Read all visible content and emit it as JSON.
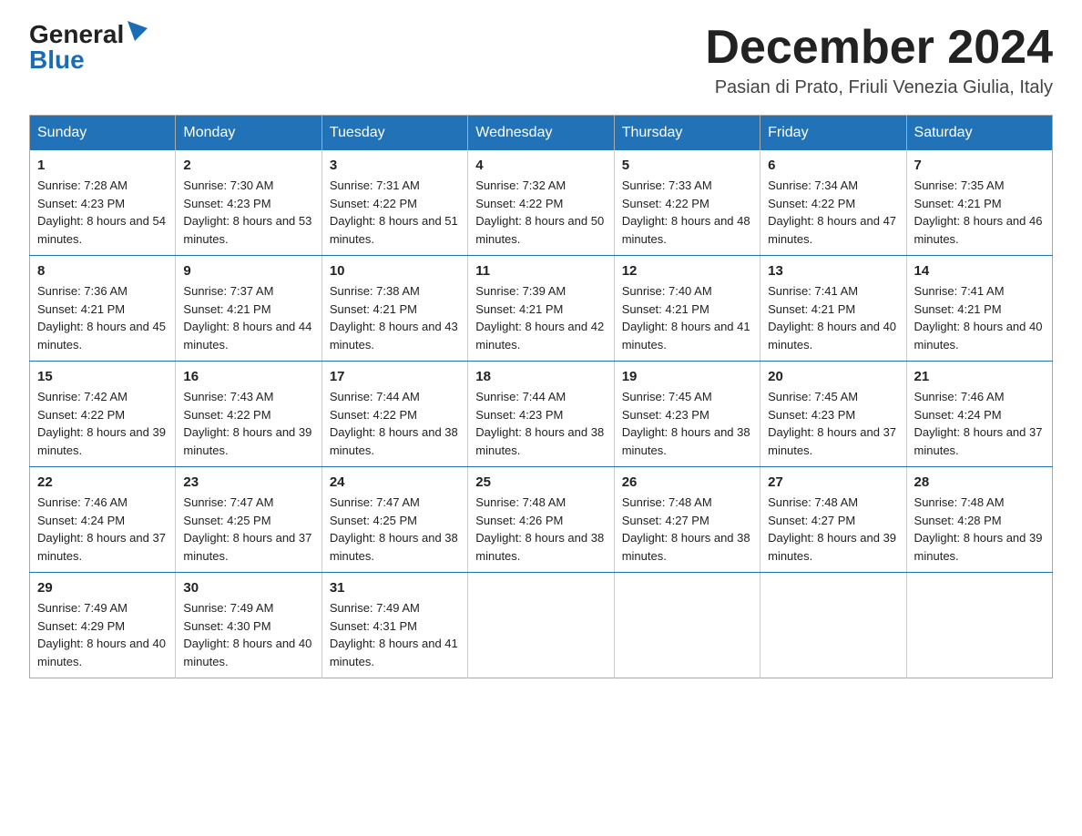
{
  "logo": {
    "general": "General",
    "blue": "Blue"
  },
  "title": "December 2024",
  "location": "Pasian di Prato, Friuli Venezia Giulia, Italy",
  "days_of_week": [
    "Sunday",
    "Monday",
    "Tuesday",
    "Wednesday",
    "Thursday",
    "Friday",
    "Saturday"
  ],
  "weeks": [
    [
      {
        "day": "1",
        "sunrise": "7:28 AM",
        "sunset": "4:23 PM",
        "daylight": "8 hours and 54 minutes."
      },
      {
        "day": "2",
        "sunrise": "7:30 AM",
        "sunset": "4:23 PM",
        "daylight": "8 hours and 53 minutes."
      },
      {
        "day": "3",
        "sunrise": "7:31 AM",
        "sunset": "4:22 PM",
        "daylight": "8 hours and 51 minutes."
      },
      {
        "day": "4",
        "sunrise": "7:32 AM",
        "sunset": "4:22 PM",
        "daylight": "8 hours and 50 minutes."
      },
      {
        "day": "5",
        "sunrise": "7:33 AM",
        "sunset": "4:22 PM",
        "daylight": "8 hours and 48 minutes."
      },
      {
        "day": "6",
        "sunrise": "7:34 AM",
        "sunset": "4:22 PM",
        "daylight": "8 hours and 47 minutes."
      },
      {
        "day": "7",
        "sunrise": "7:35 AM",
        "sunset": "4:21 PM",
        "daylight": "8 hours and 46 minutes."
      }
    ],
    [
      {
        "day": "8",
        "sunrise": "7:36 AM",
        "sunset": "4:21 PM",
        "daylight": "8 hours and 45 minutes."
      },
      {
        "day": "9",
        "sunrise": "7:37 AM",
        "sunset": "4:21 PM",
        "daylight": "8 hours and 44 minutes."
      },
      {
        "day": "10",
        "sunrise": "7:38 AM",
        "sunset": "4:21 PM",
        "daylight": "8 hours and 43 minutes."
      },
      {
        "day": "11",
        "sunrise": "7:39 AM",
        "sunset": "4:21 PM",
        "daylight": "8 hours and 42 minutes."
      },
      {
        "day": "12",
        "sunrise": "7:40 AM",
        "sunset": "4:21 PM",
        "daylight": "8 hours and 41 minutes."
      },
      {
        "day": "13",
        "sunrise": "7:41 AM",
        "sunset": "4:21 PM",
        "daylight": "8 hours and 40 minutes."
      },
      {
        "day": "14",
        "sunrise": "7:41 AM",
        "sunset": "4:21 PM",
        "daylight": "8 hours and 40 minutes."
      }
    ],
    [
      {
        "day": "15",
        "sunrise": "7:42 AM",
        "sunset": "4:22 PM",
        "daylight": "8 hours and 39 minutes."
      },
      {
        "day": "16",
        "sunrise": "7:43 AM",
        "sunset": "4:22 PM",
        "daylight": "8 hours and 39 minutes."
      },
      {
        "day": "17",
        "sunrise": "7:44 AM",
        "sunset": "4:22 PM",
        "daylight": "8 hours and 38 minutes."
      },
      {
        "day": "18",
        "sunrise": "7:44 AM",
        "sunset": "4:23 PM",
        "daylight": "8 hours and 38 minutes."
      },
      {
        "day": "19",
        "sunrise": "7:45 AM",
        "sunset": "4:23 PM",
        "daylight": "8 hours and 38 minutes."
      },
      {
        "day": "20",
        "sunrise": "7:45 AM",
        "sunset": "4:23 PM",
        "daylight": "8 hours and 37 minutes."
      },
      {
        "day": "21",
        "sunrise": "7:46 AM",
        "sunset": "4:24 PM",
        "daylight": "8 hours and 37 minutes."
      }
    ],
    [
      {
        "day": "22",
        "sunrise": "7:46 AM",
        "sunset": "4:24 PM",
        "daylight": "8 hours and 37 minutes."
      },
      {
        "day": "23",
        "sunrise": "7:47 AM",
        "sunset": "4:25 PM",
        "daylight": "8 hours and 37 minutes."
      },
      {
        "day": "24",
        "sunrise": "7:47 AM",
        "sunset": "4:25 PM",
        "daylight": "8 hours and 38 minutes."
      },
      {
        "day": "25",
        "sunrise": "7:48 AM",
        "sunset": "4:26 PM",
        "daylight": "8 hours and 38 minutes."
      },
      {
        "day": "26",
        "sunrise": "7:48 AM",
        "sunset": "4:27 PM",
        "daylight": "8 hours and 38 minutes."
      },
      {
        "day": "27",
        "sunrise": "7:48 AM",
        "sunset": "4:27 PM",
        "daylight": "8 hours and 39 minutes."
      },
      {
        "day": "28",
        "sunrise": "7:48 AM",
        "sunset": "4:28 PM",
        "daylight": "8 hours and 39 minutes."
      }
    ],
    [
      {
        "day": "29",
        "sunrise": "7:49 AM",
        "sunset": "4:29 PM",
        "daylight": "8 hours and 40 minutes."
      },
      {
        "day": "30",
        "sunrise": "7:49 AM",
        "sunset": "4:30 PM",
        "daylight": "8 hours and 40 minutes."
      },
      {
        "day": "31",
        "sunrise": "7:49 AM",
        "sunset": "4:31 PM",
        "daylight": "8 hours and 41 minutes."
      },
      null,
      null,
      null,
      null
    ]
  ],
  "labels": {
    "sunrise": "Sunrise:",
    "sunset": "Sunset:",
    "daylight": "Daylight:"
  }
}
